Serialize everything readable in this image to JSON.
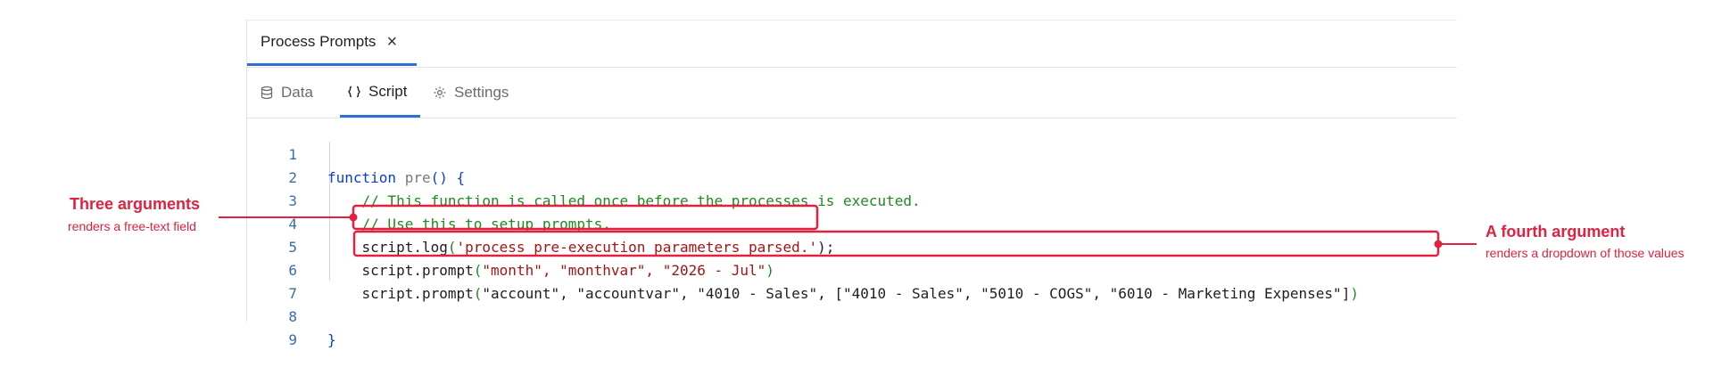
{
  "doc_tab": {
    "title": "Process Prompts",
    "close_glyph": "×"
  },
  "subtabs": [
    {
      "label": "Data",
      "icon": "database-icon"
    },
    {
      "label": "Script",
      "icon": "braces-icon"
    },
    {
      "label": "Settings",
      "icon": "gear-icon"
    }
  ],
  "code": {
    "line_numbers": [
      "1",
      "2",
      "3",
      "4",
      "5",
      "6",
      "7",
      "8",
      "9"
    ],
    "l1": {
      "kw": "function",
      "fn": " pre",
      "punct": "() {"
    },
    "l2": "    // This function is called once before the processes is executed.",
    "l3": "    // Use this to setup prompts.",
    "l4": {
      "indent": "    ",
      "obj": "script.log",
      "paren": "(",
      "str": "'process pre-execution parameters parsed.'",
      "end": ");"
    },
    "l5": {
      "indent": "    ",
      "obj": "script.prompt",
      "paren": "(",
      "args": "\"month\", \"monthvar\", \"2026 - Jul\"",
      "end": ")"
    },
    "l6": {
      "indent": "    ",
      "obj": "script.prompt",
      "paren": "(",
      "args": "\"account\", \"accountvar\", \"4010 - Sales\", [\"4010 - Sales\", \"5010 - COGS\", \"6010 - Marketing Expenses\"]",
      "end": ")"
    },
    "l8": "}"
  },
  "callouts": {
    "left": {
      "title": "Three arguments",
      "subtitle": "renders a free-text field"
    },
    "right": {
      "title": "A fourth argument",
      "subtitle": "renders a dropdown of those values"
    }
  },
  "colors": {
    "accent": "#2f6fd6",
    "annotation": "#e1213f"
  }
}
